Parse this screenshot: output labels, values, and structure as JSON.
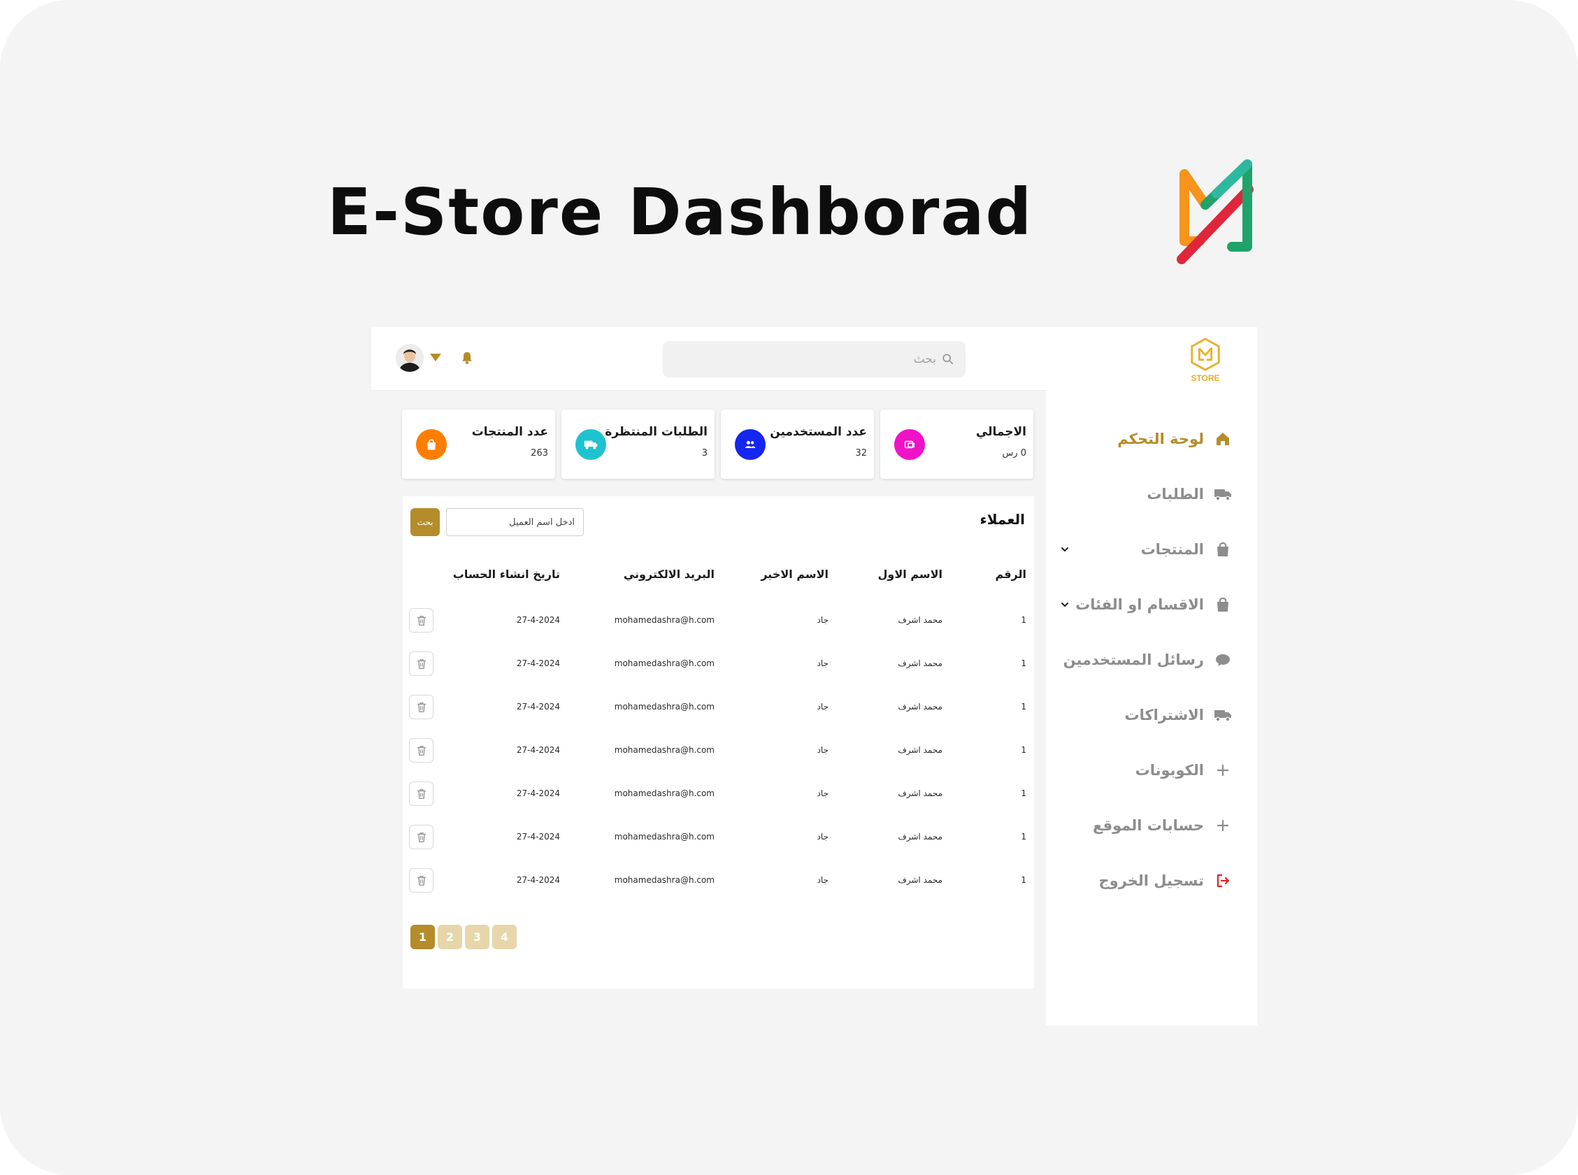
{
  "hero": {
    "title": "E-Store Dashborad"
  },
  "colors": {
    "accent": "#b58c2a",
    "accent_light": "#e6d6aa",
    "logout": "#e02424"
  },
  "topbar": {
    "search_placeholder": "بحث"
  },
  "sidebar": {
    "logo_text": "STORE",
    "items": [
      {
        "label": "لوحة التحكم",
        "icon": "home-icon",
        "active": true
      },
      {
        "label": "الطلبات",
        "icon": "truck-icon"
      },
      {
        "label": "المنتجات",
        "icon": "bag-icon",
        "expandable": true
      },
      {
        "label": "الاقسام او الفئات",
        "icon": "bag-icon",
        "expandable": true
      },
      {
        "label": "رسائل المستخدمين",
        "icon": "chat-icon"
      },
      {
        "label": "الاشتراكات",
        "icon": "truck-icon"
      },
      {
        "label": "الكوبونات",
        "icon": "plus-icon"
      },
      {
        "label": "حسابات الموقع",
        "icon": "plus-icon"
      },
      {
        "label": "تسجيل الخروج",
        "icon": "logout-icon"
      }
    ]
  },
  "stats": [
    {
      "label": "الاجمالي",
      "value": "0 رس",
      "icon": "wallet-icon",
      "color": "#f012c8"
    },
    {
      "label": "عدد المستخدمين",
      "value": "32",
      "icon": "users-icon",
      "color": "#1526f0"
    },
    {
      "label": "الطلبات المنتظرة",
      "value": "3",
      "icon": "truck-icon",
      "color": "#1fc3cf"
    },
    {
      "label": "عدد المنتجات",
      "value": "263",
      "icon": "bag-icon",
      "color": "#ff7d00"
    }
  ],
  "customers": {
    "title": "العملاء",
    "search_placeholder": "ادخل اسم العميل",
    "search_button": "بحث",
    "columns": [
      "الرقم",
      "الاسم الاول",
      "الاسم الاخير",
      "البريد الالكتروني",
      "تاريخ انشاء الحساب"
    ],
    "rows": [
      [
        "1",
        "محمد اشرف",
        "جاد",
        "mohamedashra@h.com",
        "27-4-2024"
      ],
      [
        "1",
        "محمد اشرف",
        "جاد",
        "mohamedashra@h.com",
        "27-4-2024"
      ],
      [
        "1",
        "محمد اشرف",
        "جاد",
        "mohamedashra@h.com",
        "27-4-2024"
      ],
      [
        "1",
        "محمد اشرف",
        "جاد",
        "mohamedashra@h.com",
        "27-4-2024"
      ],
      [
        "1",
        "محمد اشرف",
        "جاد",
        "mohamedashra@h.com",
        "27-4-2024"
      ],
      [
        "1",
        "محمد اشرف",
        "جاد",
        "mohamedashra@h.com",
        "27-4-2024"
      ],
      [
        "1",
        "محمد اشرف",
        "جاد",
        "mohamedashra@h.com",
        "27-4-2024"
      ]
    ],
    "pages": [
      "1",
      "2",
      "3",
      "4"
    ],
    "current_page": "1"
  }
}
